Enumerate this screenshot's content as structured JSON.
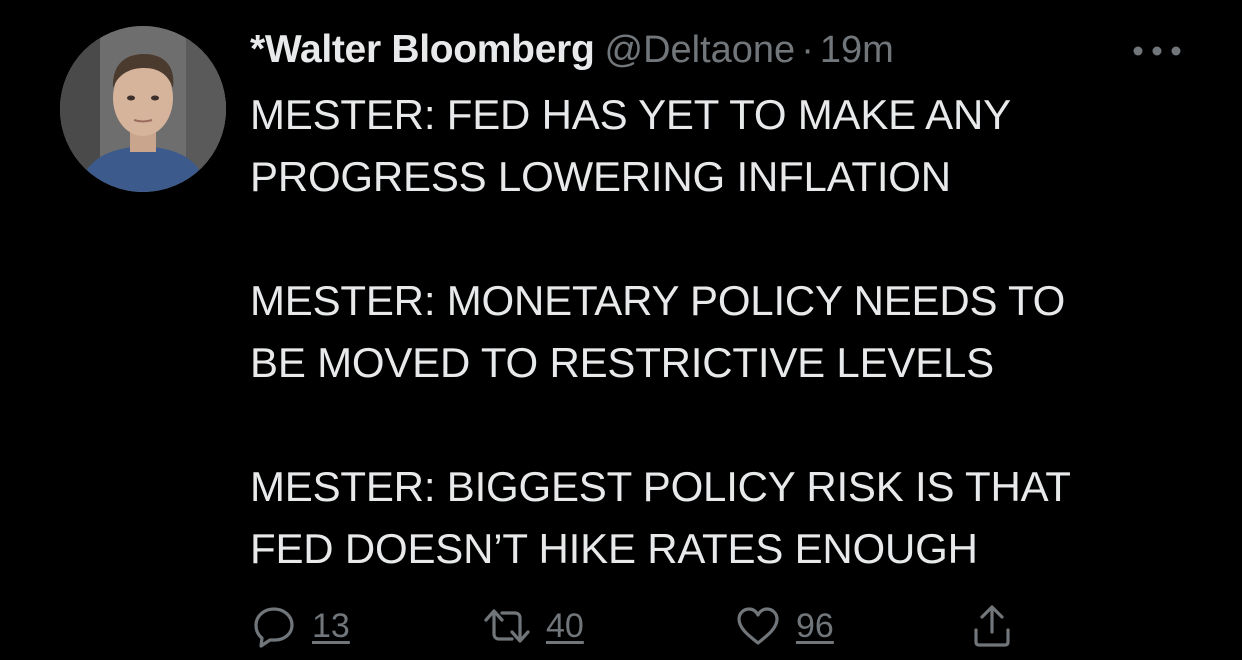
{
  "author": {
    "display_name": "*Walter Bloomberg",
    "handle": "@Deltaone",
    "separator": "·",
    "time": "19m"
  },
  "tweet": {
    "paragraphs": [
      {
        "lines": [
          "MESTER: FED HAS YET TO MAKE ANY",
          "PROGRESS LOWERING INFLATION"
        ]
      },
      {
        "lines": [
          "MESTER: MONETARY POLICY NEEDS TO",
          "BE MOVED TO RESTRICTIVE LEVELS"
        ]
      },
      {
        "lines": [
          "MESTER: BIGGEST POLICY RISK IS THAT",
          "FED DOESN’T HIKE RATES ENOUGH"
        ]
      }
    ]
  },
  "actions": {
    "reply_count": "13",
    "retweet_count": "40",
    "like_count": "96"
  },
  "icons": {
    "reply": "reply-icon",
    "retweet": "retweet-icon",
    "like": "heart-icon",
    "share": "share-icon",
    "more": "more-icon"
  },
  "colors": {
    "background": "#000000",
    "text_primary": "#e7e9ea",
    "text_secondary": "#71767b"
  }
}
